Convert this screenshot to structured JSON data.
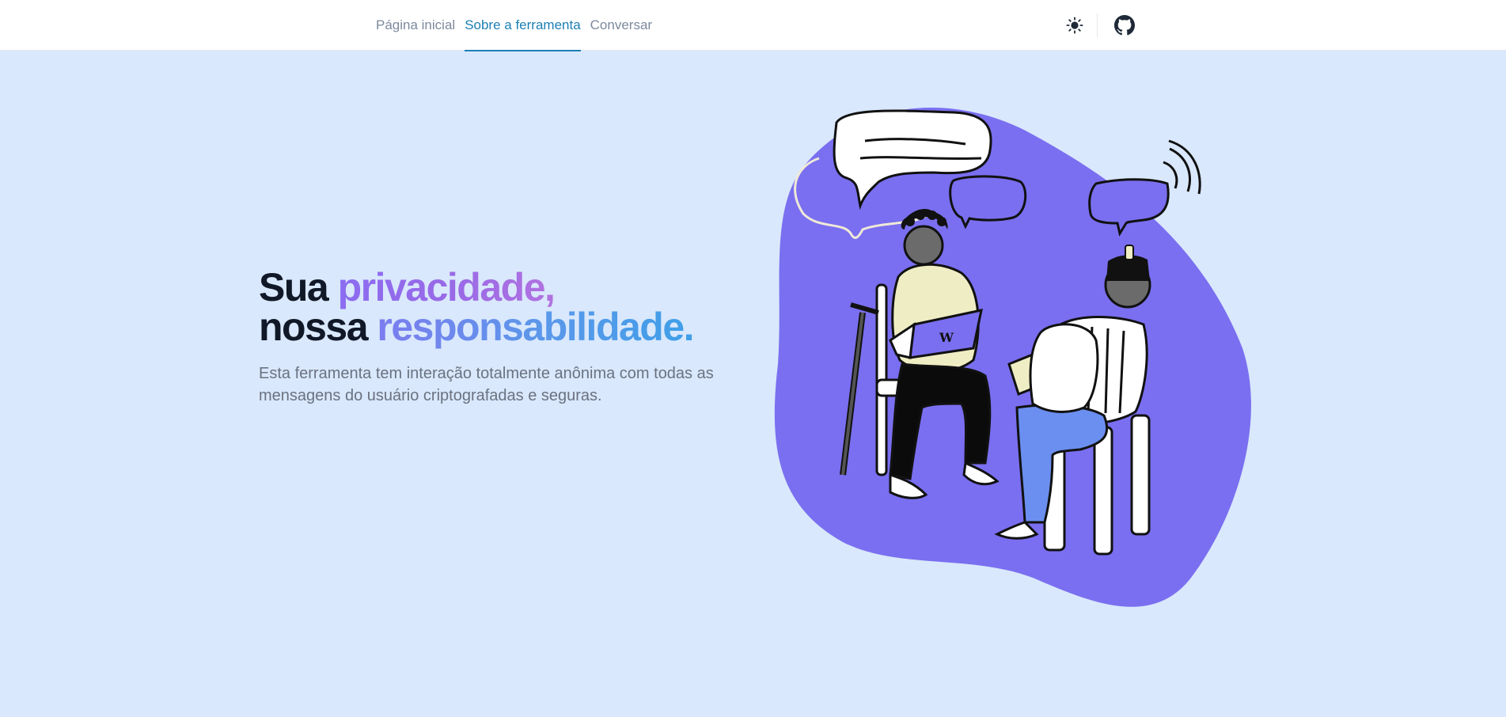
{
  "nav": {
    "items": [
      {
        "label": "Página inicial",
        "active": false
      },
      {
        "label": "Sobre a ferramenta",
        "active": true
      },
      {
        "label": "Conversar",
        "active": false
      }
    ]
  },
  "header": {
    "theme_toggle_icon": "sun-icon",
    "repo_icon": "github-icon"
  },
  "hero": {
    "line1_plain": "Sua ",
    "line1_highlight": "privacidade,",
    "line2_plain": "nossa ",
    "line2_highlight": "responsabilidade.",
    "description": "Esta ferramenta tem interação totalmente anônima com todas as mensagens do usuário criptografadas e seguras."
  },
  "illustration": {
    "laptop_logo": "W"
  },
  "colors": {
    "background": "#d9e8fc",
    "accent": "#1b7fb5",
    "blob": "#7a6ff0"
  }
}
